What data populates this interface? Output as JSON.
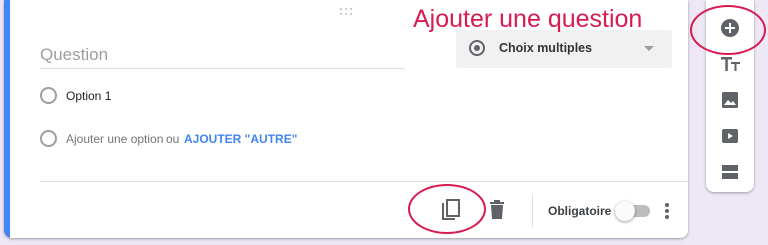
{
  "annotation": {
    "title": "Ajouter une question",
    "color": "#d81b50"
  },
  "question": {
    "placeholder": "Question"
  },
  "type_select": {
    "selected": "Choix multiples"
  },
  "options": [
    {
      "label": "Option 1"
    }
  ],
  "add_option": {
    "label": "Ajouter une option",
    "or": "ou",
    "add_other": "AJOUTER \"AUTRE\""
  },
  "footer": {
    "required_label": "Obligatoire",
    "required_on": false
  },
  "colors": {
    "accent": "#4285f4",
    "icon": "#5f6368",
    "background": "#ede7f6"
  },
  "icons": {
    "footer": [
      "copy-icon",
      "trash-icon",
      "more-vertical-icon"
    ],
    "toolbar": [
      "add-circle-icon",
      "title-text-icon",
      "image-icon",
      "video-icon",
      "section-icon"
    ]
  }
}
